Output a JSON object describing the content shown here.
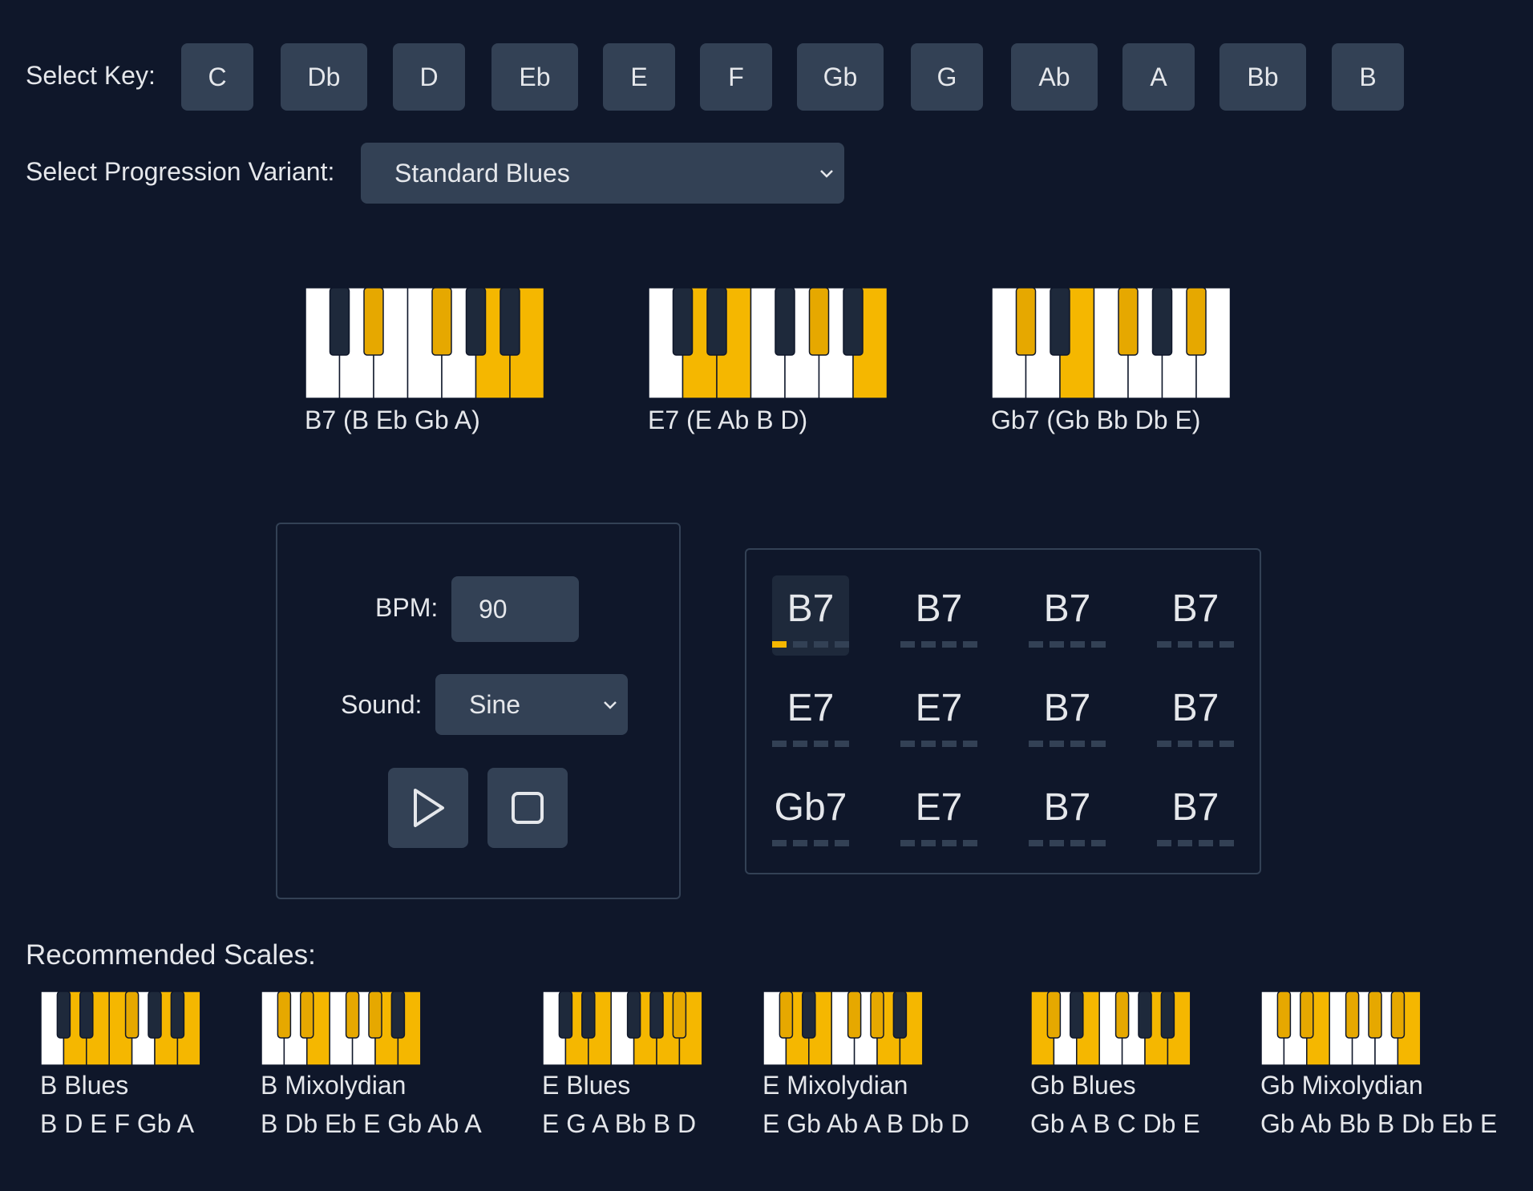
{
  "key_select": {
    "label": "Select Key:",
    "keys": [
      "C",
      "Db",
      "D",
      "Eb",
      "E",
      "F",
      "Gb",
      "G",
      "Ab",
      "A",
      "Bb",
      "B"
    ]
  },
  "progression": {
    "label": "Select Progression Variant:",
    "value": "Standard Blues"
  },
  "chords": [
    {
      "caption": "B7 (B Eb Gb A)",
      "notes": [
        3,
        6,
        9,
        11
      ],
      "lit": [
        10
      ]
    },
    {
      "caption": "E7 (E Ab B D)",
      "notes": [
        2,
        4,
        8,
        11
      ],
      "lit": [
        7
      ]
    },
    {
      "caption": "Gb7 (Gb Bb Db E)",
      "notes": [
        1,
        4,
        6,
        10
      ],
      "lit": []
    }
  ],
  "controls": {
    "bpm_label": "BPM:",
    "bpm_value": "90",
    "sound_label": "Sound:",
    "sound_value": "Sine",
    "play_icon": "play-icon",
    "stop_icon": "stop-icon"
  },
  "grid": {
    "rows": [
      [
        "B7",
        "B7",
        "B7",
        "B7"
      ],
      [
        "E7",
        "E7",
        "B7",
        "B7"
      ],
      [
        "Gb7",
        "E7",
        "B7",
        "B7"
      ]
    ],
    "active_cell": 0,
    "active_beat": 0
  },
  "scales": {
    "heading": "Recommended Scales:",
    "items": [
      {
        "name": "B Blues",
        "notes": "B D E F Gb A",
        "highlight": [
          2,
          4,
          5,
          6,
          9,
          11
        ]
      },
      {
        "name": "B Mixolydian",
        "notes": "B Db Eb E Gb Ab A",
        "highlight": [
          1,
          3,
          4,
          6,
          8,
          9,
          11
        ]
      },
      {
        "name": "E Blues",
        "notes": "E G A Bb B D",
        "highlight": [
          2,
          4,
          7,
          9,
          10,
          11
        ]
      },
      {
        "name": "E Mixolydian",
        "notes": "E Gb Ab A B Db D",
        "highlight": [
          1,
          2,
          4,
          6,
          8,
          9,
          11
        ]
      },
      {
        "name": "Gb Blues",
        "notes": "Gb A B C Db E",
        "highlight": [
          0,
          1,
          4,
          6,
          9,
          11
        ]
      },
      {
        "name": "Gb Mixolydian",
        "notes": "Gb Ab Bb B Db Eb E",
        "highlight": [
          1,
          3,
          4,
          6,
          8,
          10,
          11
        ]
      }
    ]
  },
  "colors": {
    "background": "#0f172a",
    "button": "#334155",
    "accent": "#f5b700",
    "text": "#e5e7eb"
  }
}
